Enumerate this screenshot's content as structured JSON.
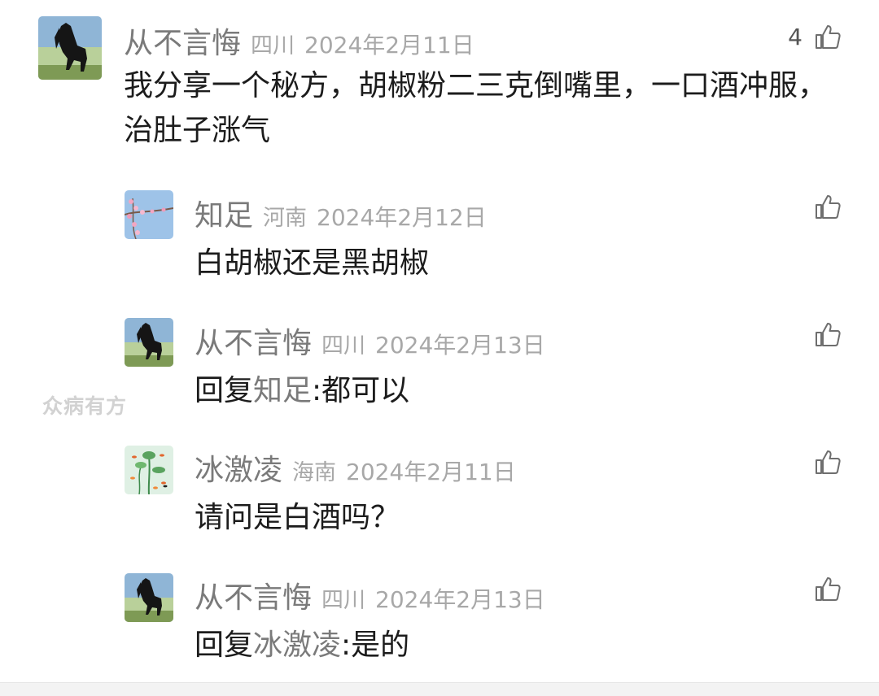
{
  "comments": [
    {
      "name": "从不言悔",
      "location": "四川",
      "date": "2024年2月11日",
      "likes": "4",
      "text": "我分享一个秘方，胡椒粉二三克倒嘴里，一口酒冲服，治肚子涨气",
      "avatar_icon": "black-horse-avatar-icon"
    }
  ],
  "replies": [
    {
      "name": "知足",
      "location": "河南",
      "date": "2024年2月12日",
      "text": "白胡椒还是黑胡椒",
      "avatar_icon": "blossom-avatar-icon"
    },
    {
      "name": "从不言悔",
      "location": "四川",
      "date": "2024年2月13日",
      "reply_prefix": "回复",
      "reply_target": "知足",
      "text": ":都可以",
      "avatar_icon": "black-horse-avatar-icon"
    },
    {
      "name": "冰激凌",
      "location": "海南",
      "date": "2024年2月11日",
      "text": "请问是白酒吗？",
      "avatar_icon": "lotus-goldfish-avatar-icon"
    },
    {
      "name": "从不言悔",
      "location": "四川",
      "date": "2024年2月13日",
      "reply_prefix": "回复",
      "reply_target": "冰激凌",
      "text": ":是的",
      "avatar_icon": "black-horse-avatar-icon"
    }
  ],
  "watermark": "众病有方",
  "icons": {
    "like": "thumbs-up-icon"
  },
  "colors": {
    "name": "#7a7a7a",
    "meta": "#a8a8a8",
    "body": "#1c1c1c",
    "icon": "#6e6e6e"
  }
}
